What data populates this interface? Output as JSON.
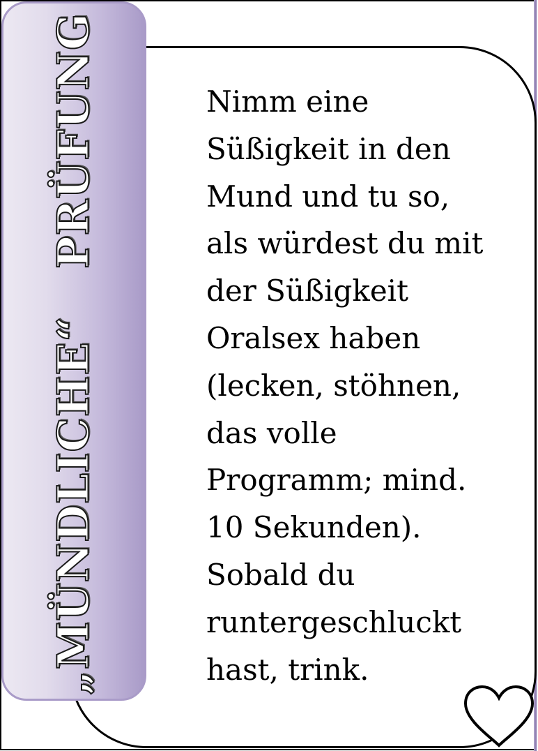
{
  "card": {
    "title": "„MÜNDLICHE“   PRÜFUNG",
    "text_lines": [
      "Nimm eine",
      "Süßigkeit in den",
      "Mund und tu so,",
      "als würdest du mit",
      "der Süßigkeit",
      "Oralsex haben",
      "(lecken, stöhnen,",
      "das volle",
      "Programm; mind.",
      "10 Sekunden).",
      "Sobald du",
      "runtergeschluckt",
      "hast, trink."
    ]
  },
  "colors": {
    "banner_light": "#ece8f2",
    "banner_dark": "#a99bc8",
    "border": "#000000"
  },
  "icons": {
    "corner": "heart-outline-icon"
  }
}
